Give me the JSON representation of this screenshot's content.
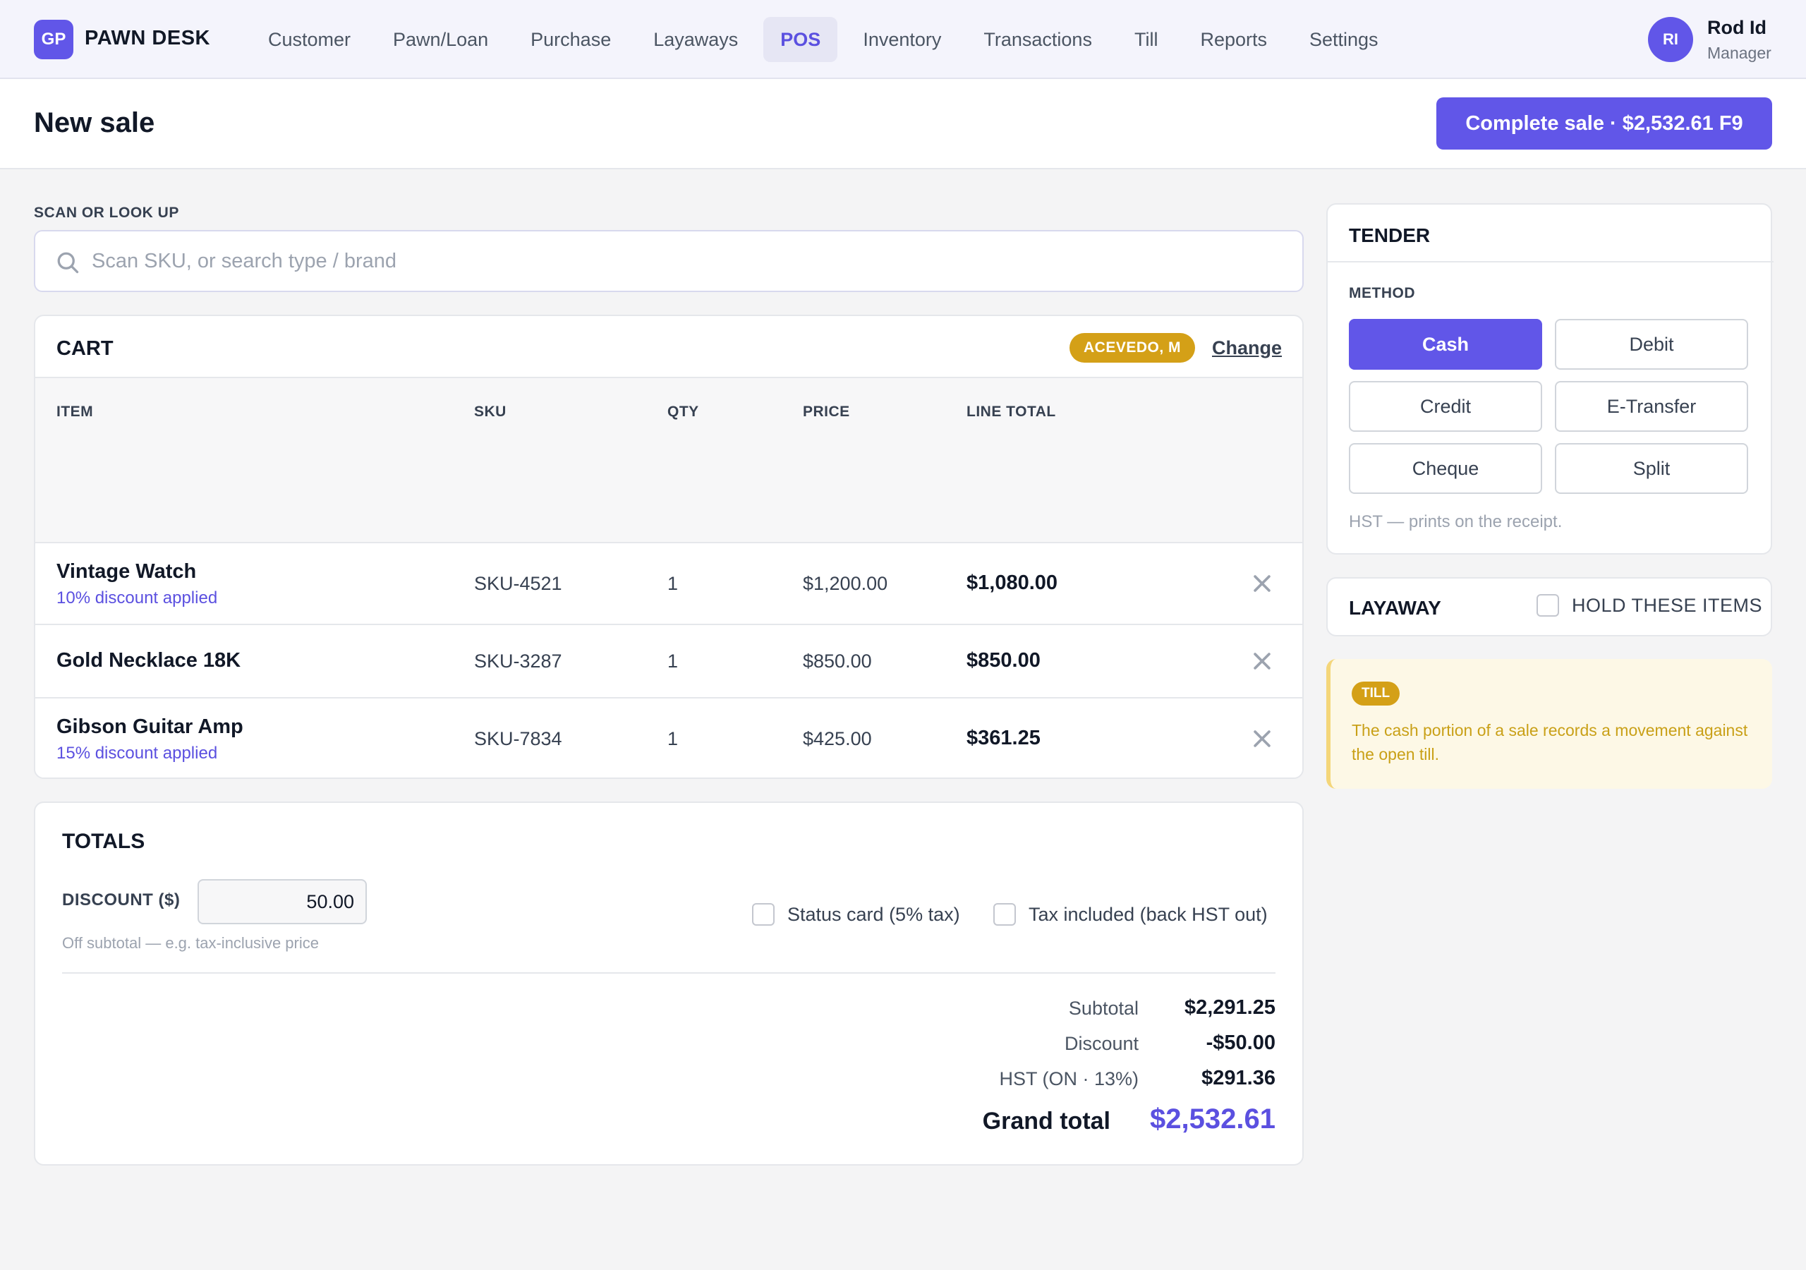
{
  "app": {
    "logo_initials": "GP",
    "brand": "PAWN DESK"
  },
  "nav": {
    "items": [
      {
        "label": "Customer"
      },
      {
        "label": "Pawn/Loan"
      },
      {
        "label": "Purchase"
      },
      {
        "label": "Layaways"
      },
      {
        "label": "POS",
        "active": true
      },
      {
        "label": "Inventory"
      },
      {
        "label": "Transactions"
      },
      {
        "label": "Till"
      },
      {
        "label": "Reports"
      },
      {
        "label": "Settings"
      }
    ]
  },
  "user": {
    "initials": "RI",
    "name": "Rod Id",
    "role": "Manager"
  },
  "page": {
    "title": "New sale",
    "complete_button": "Complete sale · $2,532.61 F9"
  },
  "scan": {
    "label": "SCAN OR LOOK UP",
    "placeholder": "Scan SKU, or search type / brand",
    "icon": "search-icon"
  },
  "cart": {
    "title": "CART",
    "customer_badge": "ACEVEDO, M",
    "change_link": "Change",
    "columns": [
      "ITEM",
      "SKU",
      "QTY",
      "PRICE",
      "LINE TOTAL"
    ],
    "rows": [
      {
        "name": "Vintage Watch",
        "discount": "10% discount applied",
        "sku": "SKU-4521",
        "qty": "1",
        "price": "$1,200.00",
        "line_total": "$1,080.00"
      },
      {
        "name": "Gold Necklace 18K",
        "discount": "",
        "sku": "SKU-3287",
        "qty": "1",
        "price": "$850.00",
        "line_total": "$850.00"
      },
      {
        "name": "Gibson Guitar Amp",
        "discount": "15% discount applied",
        "sku": "SKU-7834",
        "qty": "1",
        "price": "$425.00",
        "line_total": "$361.25"
      }
    ],
    "remove_icon": "close-icon"
  },
  "totals": {
    "title": "TOTALS",
    "discount_label": "DISCOUNT ($)",
    "discount_value": "50.00",
    "discount_hint": "Off subtotal — e.g. tax-inclusive price",
    "status_card_label": "Status card (5% tax)",
    "status_card_checked": false,
    "tax_included_label": "Tax included (back HST out)",
    "tax_included_checked": false,
    "subtotal_label": "Subtotal",
    "subtotal_value": "$2,291.25",
    "discount_sum_label": "Discount",
    "discount_sum_value": "-$50.00",
    "hst_label": "HST (ON · 13%)",
    "hst_value": "$291.36",
    "grand_label": "Grand total",
    "grand_value": "$2,532.61",
    "colors": {
      "accent": "#6156e8",
      "grand_total": "#5b50e0"
    }
  },
  "tender": {
    "title": "TENDER",
    "method_label": "METHOD",
    "methods": [
      "Cash",
      "Debit",
      "Credit",
      "E-Transfer",
      "Cheque",
      "Split"
    ],
    "selected": "Cash",
    "note": "HST — prints on the receipt."
  },
  "layaway": {
    "title": "LAYAWAY",
    "hold_label": "HOLD THESE ITEMS",
    "hold_checked": false
  },
  "till_note": {
    "badge": "TILL",
    "text": "The cash portion of a sale records a movement against the open till.",
    "colors": {
      "badge": "#d4a017",
      "background": "#fdf8e6",
      "text": "#c9a017"
    }
  }
}
